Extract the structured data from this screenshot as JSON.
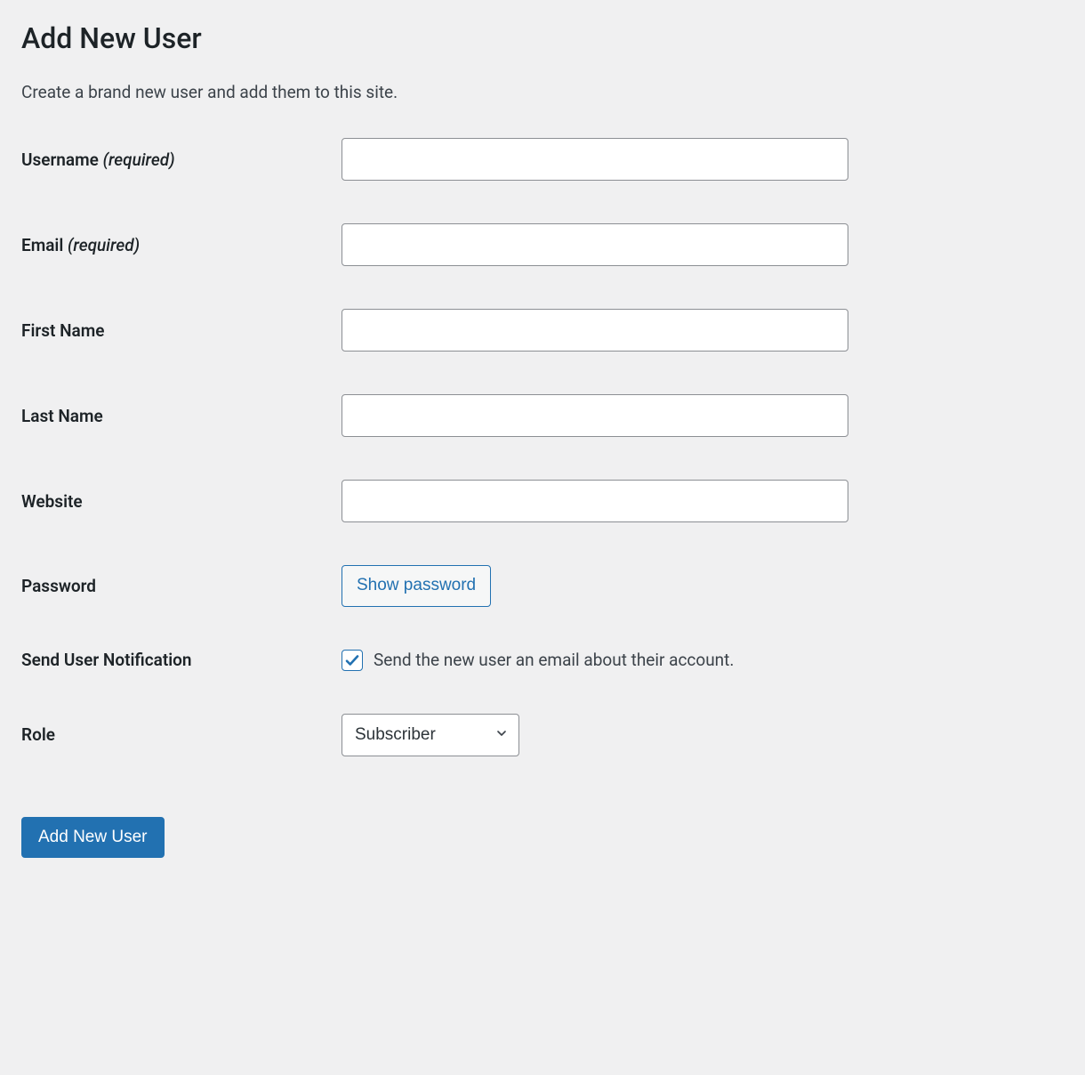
{
  "page": {
    "title": "Add New User",
    "description": "Create a brand new user and add them to this site."
  },
  "form": {
    "username": {
      "label": "Username ",
      "required_note": "(required)",
      "value": ""
    },
    "email": {
      "label": "Email ",
      "required_note": "(required)",
      "value": ""
    },
    "first_name": {
      "label": "First Name",
      "value": ""
    },
    "last_name": {
      "label": "Last Name",
      "value": ""
    },
    "website": {
      "label": "Website",
      "value": ""
    },
    "password": {
      "label": "Password",
      "show_button": "Show password"
    },
    "notification": {
      "label": "Send User Notification",
      "checkbox_label": "Send the new user an email about their account.",
      "checked": true
    },
    "role": {
      "label": "Role",
      "selected": "Subscriber"
    },
    "submit": {
      "label": "Add New User"
    }
  }
}
